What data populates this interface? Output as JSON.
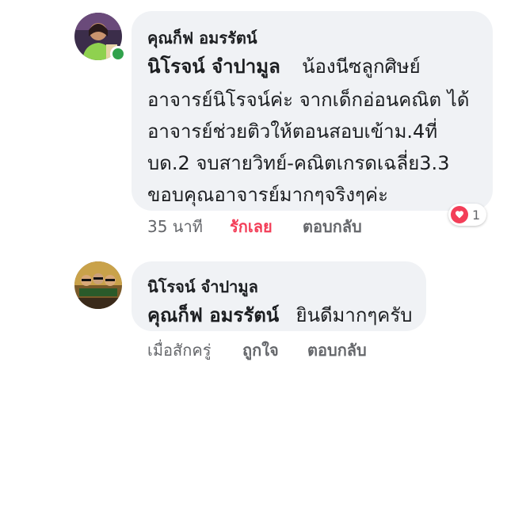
{
  "comments": [
    {
      "author": "คุณก็ฟ อมรรัตน์",
      "mention": "นิโรจน์ จำปามูล",
      "first_line_text": "น้องนีซลูกศิษย์",
      "body_lines": [
        "อาจารย์นิโรจน์ค่ะ จากเด็กอ่อนคณิต ได้",
        "อาจารย์ช่วยติวให้ตอนสอบเข้าม.4ที่",
        "บด.2 จบสายวิทย์-คณิตเกรดเฉลี่ย3.3",
        "ขอบคุณอาจารย์มากๆจริงๆค่ะ"
      ],
      "time": "35 นาที",
      "like_label": "รักเลย",
      "reply_label": "ตอบกลับ",
      "reaction": {
        "icon": "heart-icon",
        "count": "1",
        "color": "#f33e58"
      },
      "avatar_status": "online"
    },
    {
      "author": "นิโรจน์ จำปามูล",
      "mention": "คุณก็ฟ อมรรัตน์",
      "first_line_text": "ยินดีมากๆครับ",
      "time": "เมื่อสักครู่",
      "like_label": "ถูกใจ",
      "reply_label": "ตอบกลับ"
    }
  ],
  "colors": {
    "bubble": "#f0f2f5",
    "text": "#1c1e21",
    "meta": "#65676b",
    "love": "#f33e58",
    "online": "#31a24c"
  }
}
